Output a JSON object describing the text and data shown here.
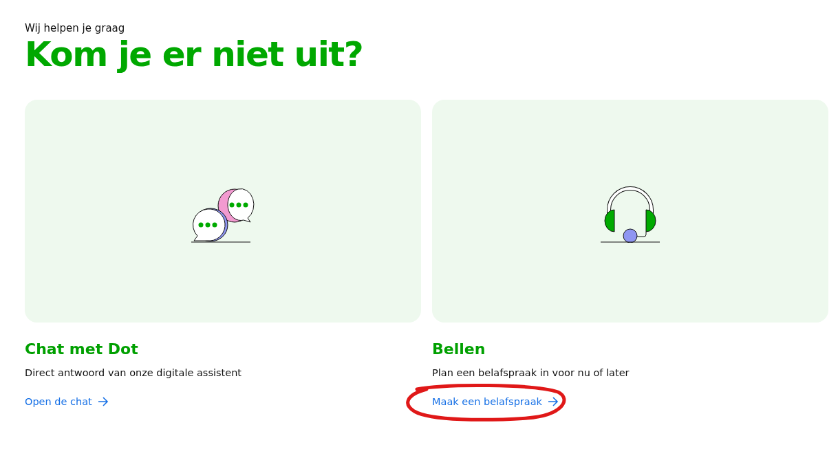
{
  "eyebrow": "Wij helpen je graag",
  "title": "Kom je er niet uit?",
  "cards": [
    {
      "kind": "chat",
      "title": "Chat met Dot",
      "description": "Direct antwoord van onze digitale assistent",
      "link": "Open de chat"
    },
    {
      "kind": "call",
      "title": "Bellen",
      "description": "Plan een belafspraak in voor nu of later",
      "link": "Maak een belafspraak",
      "annotated": true
    }
  ]
}
